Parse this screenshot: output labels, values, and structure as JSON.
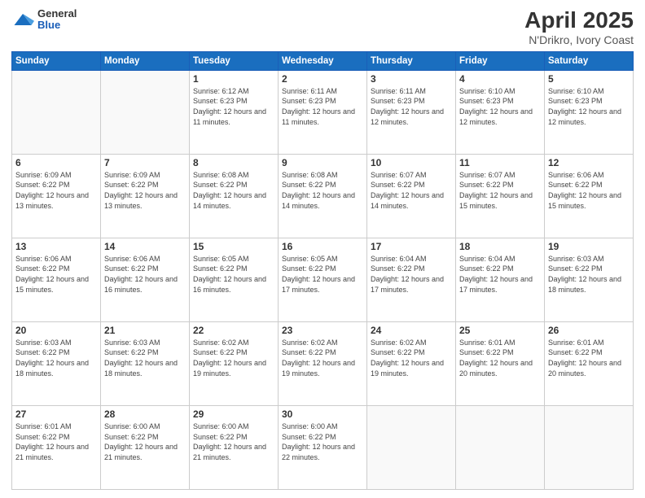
{
  "logo": {
    "general": "General",
    "blue": "Blue"
  },
  "title": "April 2025",
  "subtitle": "N'Drikro, Ivory Coast",
  "days_of_week": [
    "Sunday",
    "Monday",
    "Tuesday",
    "Wednesday",
    "Thursday",
    "Friday",
    "Saturday"
  ],
  "weeks": [
    [
      {
        "day": "",
        "info": ""
      },
      {
        "day": "",
        "info": ""
      },
      {
        "day": "1",
        "info": "Sunrise: 6:12 AM\nSunset: 6:23 PM\nDaylight: 12 hours and 11 minutes."
      },
      {
        "day": "2",
        "info": "Sunrise: 6:11 AM\nSunset: 6:23 PM\nDaylight: 12 hours and 11 minutes."
      },
      {
        "day": "3",
        "info": "Sunrise: 6:11 AM\nSunset: 6:23 PM\nDaylight: 12 hours and 12 minutes."
      },
      {
        "day": "4",
        "info": "Sunrise: 6:10 AM\nSunset: 6:23 PM\nDaylight: 12 hours and 12 minutes."
      },
      {
        "day": "5",
        "info": "Sunrise: 6:10 AM\nSunset: 6:23 PM\nDaylight: 12 hours and 12 minutes."
      }
    ],
    [
      {
        "day": "6",
        "info": "Sunrise: 6:09 AM\nSunset: 6:22 PM\nDaylight: 12 hours and 13 minutes."
      },
      {
        "day": "7",
        "info": "Sunrise: 6:09 AM\nSunset: 6:22 PM\nDaylight: 12 hours and 13 minutes."
      },
      {
        "day": "8",
        "info": "Sunrise: 6:08 AM\nSunset: 6:22 PM\nDaylight: 12 hours and 14 minutes."
      },
      {
        "day": "9",
        "info": "Sunrise: 6:08 AM\nSunset: 6:22 PM\nDaylight: 12 hours and 14 minutes."
      },
      {
        "day": "10",
        "info": "Sunrise: 6:07 AM\nSunset: 6:22 PM\nDaylight: 12 hours and 14 minutes."
      },
      {
        "day": "11",
        "info": "Sunrise: 6:07 AM\nSunset: 6:22 PM\nDaylight: 12 hours and 15 minutes."
      },
      {
        "day": "12",
        "info": "Sunrise: 6:06 AM\nSunset: 6:22 PM\nDaylight: 12 hours and 15 minutes."
      }
    ],
    [
      {
        "day": "13",
        "info": "Sunrise: 6:06 AM\nSunset: 6:22 PM\nDaylight: 12 hours and 15 minutes."
      },
      {
        "day": "14",
        "info": "Sunrise: 6:06 AM\nSunset: 6:22 PM\nDaylight: 12 hours and 16 minutes."
      },
      {
        "day": "15",
        "info": "Sunrise: 6:05 AM\nSunset: 6:22 PM\nDaylight: 12 hours and 16 minutes."
      },
      {
        "day": "16",
        "info": "Sunrise: 6:05 AM\nSunset: 6:22 PM\nDaylight: 12 hours and 17 minutes."
      },
      {
        "day": "17",
        "info": "Sunrise: 6:04 AM\nSunset: 6:22 PM\nDaylight: 12 hours and 17 minutes."
      },
      {
        "day": "18",
        "info": "Sunrise: 6:04 AM\nSunset: 6:22 PM\nDaylight: 12 hours and 17 minutes."
      },
      {
        "day": "19",
        "info": "Sunrise: 6:03 AM\nSunset: 6:22 PM\nDaylight: 12 hours and 18 minutes."
      }
    ],
    [
      {
        "day": "20",
        "info": "Sunrise: 6:03 AM\nSunset: 6:22 PM\nDaylight: 12 hours and 18 minutes."
      },
      {
        "day": "21",
        "info": "Sunrise: 6:03 AM\nSunset: 6:22 PM\nDaylight: 12 hours and 18 minutes."
      },
      {
        "day": "22",
        "info": "Sunrise: 6:02 AM\nSunset: 6:22 PM\nDaylight: 12 hours and 19 minutes."
      },
      {
        "day": "23",
        "info": "Sunrise: 6:02 AM\nSunset: 6:22 PM\nDaylight: 12 hours and 19 minutes."
      },
      {
        "day": "24",
        "info": "Sunrise: 6:02 AM\nSunset: 6:22 PM\nDaylight: 12 hours and 19 minutes."
      },
      {
        "day": "25",
        "info": "Sunrise: 6:01 AM\nSunset: 6:22 PM\nDaylight: 12 hours and 20 minutes."
      },
      {
        "day": "26",
        "info": "Sunrise: 6:01 AM\nSunset: 6:22 PM\nDaylight: 12 hours and 20 minutes."
      }
    ],
    [
      {
        "day": "27",
        "info": "Sunrise: 6:01 AM\nSunset: 6:22 PM\nDaylight: 12 hours and 21 minutes."
      },
      {
        "day": "28",
        "info": "Sunrise: 6:00 AM\nSunset: 6:22 PM\nDaylight: 12 hours and 21 minutes."
      },
      {
        "day": "29",
        "info": "Sunrise: 6:00 AM\nSunset: 6:22 PM\nDaylight: 12 hours and 21 minutes."
      },
      {
        "day": "30",
        "info": "Sunrise: 6:00 AM\nSunset: 6:22 PM\nDaylight: 12 hours and 22 minutes."
      },
      {
        "day": "",
        "info": ""
      },
      {
        "day": "",
        "info": ""
      },
      {
        "day": "",
        "info": ""
      }
    ]
  ]
}
